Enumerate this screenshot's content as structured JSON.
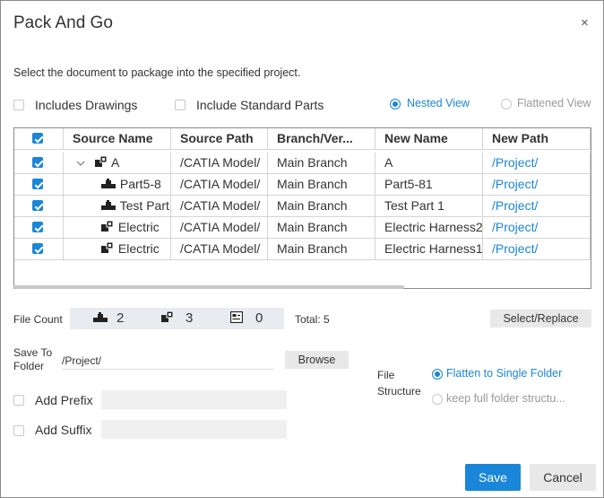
{
  "dialog": {
    "title": "Pack And Go",
    "close_glyph": "×",
    "description": "Select the document to package into the specified project."
  },
  "options": {
    "includes_drawings": {
      "label": "Includes Drawings",
      "checked": false
    },
    "include_standard_parts": {
      "label": "Include Standard Parts",
      "checked": false
    },
    "nested_view": {
      "label": "Nested View",
      "selected": true
    },
    "flattened_view": {
      "label": "Flattened View",
      "selected": false
    }
  },
  "table": {
    "columns": [
      "Source Name",
      "Source Path",
      "Branch/Ver...",
      "New Name",
      "New Path"
    ],
    "rows": [
      {
        "checked": true,
        "source_name": "A",
        "source_path": "/CATIA Model/",
        "branch": "Main Branch",
        "new_name": "A",
        "new_path": "/Project/",
        "icon": "assembly-icon",
        "expand": "chevron-down"
      },
      {
        "checked": true,
        "source_name": "Part5-8",
        "source_path": "/CATIA Model/",
        "branch": "Main Branch",
        "new_name": "Part5-81",
        "new_path": "/Project/",
        "icon": "part-icon"
      },
      {
        "checked": true,
        "source_name": "Test Part",
        "source_path": "/CATIA Model/",
        "branch": "Main Branch",
        "new_name": "Test Part 1",
        "new_path": "/Project/",
        "icon": "part-icon"
      },
      {
        "checked": true,
        "source_name": "Electric",
        "source_path": "/CATIA Model/",
        "branch": "Main Branch",
        "new_name": "Electric Harness2",
        "new_path": "/Project/",
        "icon": "assembly-icon"
      },
      {
        "checked": true,
        "source_name": "Electric",
        "source_path": "/CATIA Model/",
        "branch": "Main Branch",
        "new_name": "Electric Harness1",
        "new_path": "/Project/",
        "icon": "assembly-icon"
      }
    ]
  },
  "file_count": {
    "label": "File Count",
    "parts": "2",
    "assemblies": "3",
    "drawings": "0",
    "total": "Total: 5",
    "select_replace": "Select/Replace"
  },
  "save_to": {
    "label_line1": "Save To",
    "label_line2": "Folder",
    "value": "/Project/",
    "browse": "Browse"
  },
  "prefix": {
    "label": "Add Prefix",
    "checked": false
  },
  "suffix": {
    "label": "Add Suffix",
    "checked": false
  },
  "file_structure": {
    "label_line1": "File",
    "label_line2": "Structure",
    "flatten": {
      "label": "Flatten to Single Folder",
      "selected": true
    },
    "keep": {
      "label": "keep full folder structu...",
      "selected": false
    }
  },
  "buttons": {
    "save": "Save",
    "cancel": "Cancel"
  },
  "colors": {
    "accent": "#1a86d8"
  }
}
